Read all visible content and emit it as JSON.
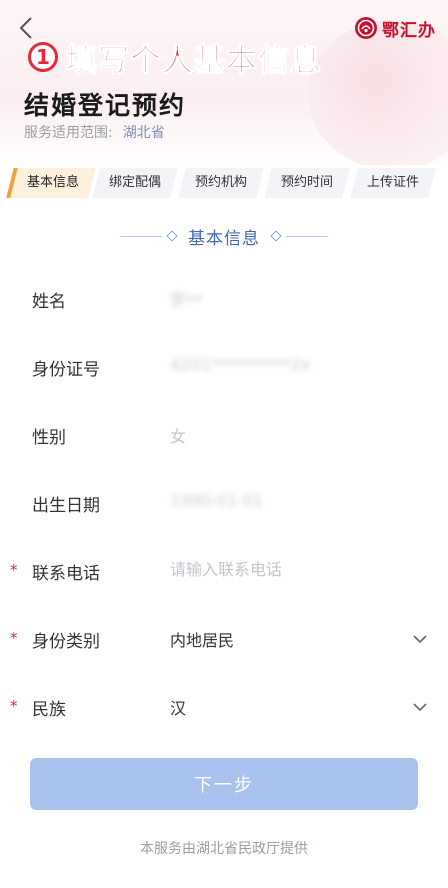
{
  "header": {
    "step_number": "1",
    "step_title": "填写个人基本信息",
    "brand_name": "鄂汇办",
    "page_title": "结婚登记预约",
    "scope_label": "服务适用范围:",
    "scope_value": "湖北省"
  },
  "tabs": [
    {
      "label": "基本信息",
      "active": true
    },
    {
      "label": "绑定配偶",
      "active": false
    },
    {
      "label": "预约机构",
      "active": false
    },
    {
      "label": "预约时间",
      "active": false
    },
    {
      "label": "上传证件",
      "active": false
    }
  ],
  "section": {
    "title": "基本信息"
  },
  "form": {
    "name": {
      "label": "姓名",
      "value": "罗**"
    },
    "id_number": {
      "label": "身份证号",
      "value": "4201**********2x"
    },
    "gender": {
      "label": "性别",
      "value": "女"
    },
    "birth_date": {
      "label": "出生日期",
      "value": "1990-01-01"
    },
    "phone": {
      "label": "联系电话",
      "placeholder": "请输入联系电话",
      "required": "*"
    },
    "id_type": {
      "label": "身份类别",
      "value": "内地居民",
      "required": "*"
    },
    "ethnicity": {
      "label": "民族",
      "value": "汉",
      "required": "*"
    }
  },
  "next_button": {
    "label": "下一步"
  },
  "footer": {
    "text": "本服务由湖北省民政厅提供"
  },
  "colors": {
    "accent_red": "#e8283c",
    "primary_blue": "#a9c3ee",
    "section_blue": "#4468b0",
    "active_tab_orange": "#f0a23c"
  },
  "icons": {
    "back": "chevron-left-icon",
    "brand": "brand-logo-icon",
    "dropdown": "chevron-down-icon"
  }
}
